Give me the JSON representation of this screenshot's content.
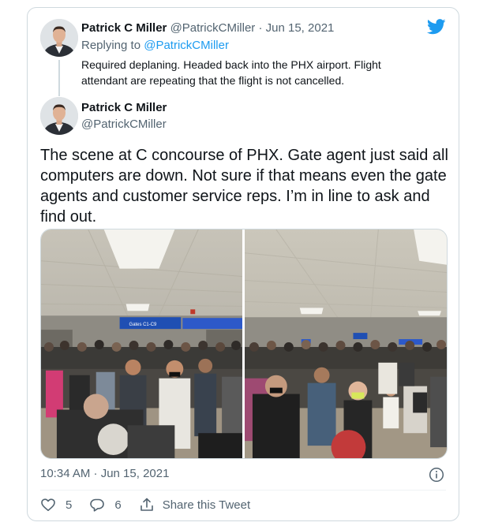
{
  "reply_tweet": {
    "author_name": "Patrick C Miller",
    "author_handle": "@PatrickCMiller",
    "separator": "·",
    "date": "Jun 15, 2021",
    "replying_prefix": "Replying to",
    "replying_to": "@PatrickCMiller",
    "text": "Required deplaning. Headed back into the PHX airport. Flight attendant are repeating that the flight is not cancelled."
  },
  "main_tweet": {
    "author_name": "Patrick C Miller",
    "author_handle": "@PatrickCMiller",
    "text": "The scene at C concourse of PHX. Gate agent just said all computers are down. Not sure if that means even the gate agents and customer service reps. I’m in line to ask and find out.",
    "timestamp": "10:34 AM · Jun 15, 2021",
    "photo_sign_text": "Gates C1-C9"
  },
  "actions": {
    "likes": "5",
    "replies": "6",
    "share_label": "Share this Tweet"
  },
  "colors": {
    "brand": "#1d9bf0",
    "text_primary": "#0f1419",
    "text_secondary": "#536471",
    "border": "#cfd9de"
  },
  "icons": [
    "twitter-bird-icon",
    "info-icon",
    "heart-icon",
    "reply-bubble-icon",
    "share-icon"
  ]
}
